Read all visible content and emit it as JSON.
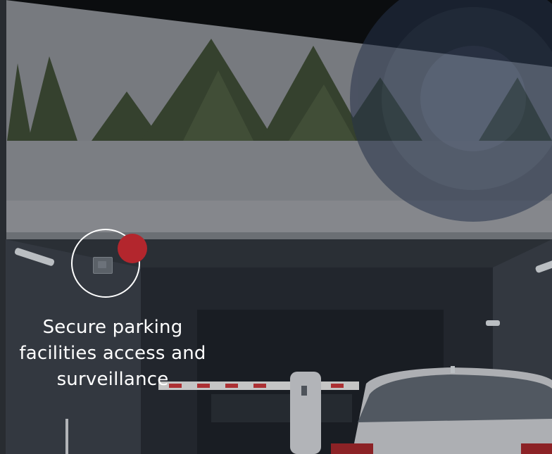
{
  "hotspot": {
    "caption_lines": [
      "Secure parking",
      "facilities access and",
      "surveillance"
    ],
    "dot_color": "#b3262d"
  },
  "scene": {
    "icons": [
      "trees",
      "garage-entrance",
      "barrier-gate",
      "car",
      "ceiling-lights",
      "camera-device"
    ]
  },
  "colors": {
    "background": "#0b0d10",
    "wall": "#8f9298",
    "tunnel": "#2a3039",
    "accent_red": "#b3262d",
    "halo": "#3a4a66"
  }
}
